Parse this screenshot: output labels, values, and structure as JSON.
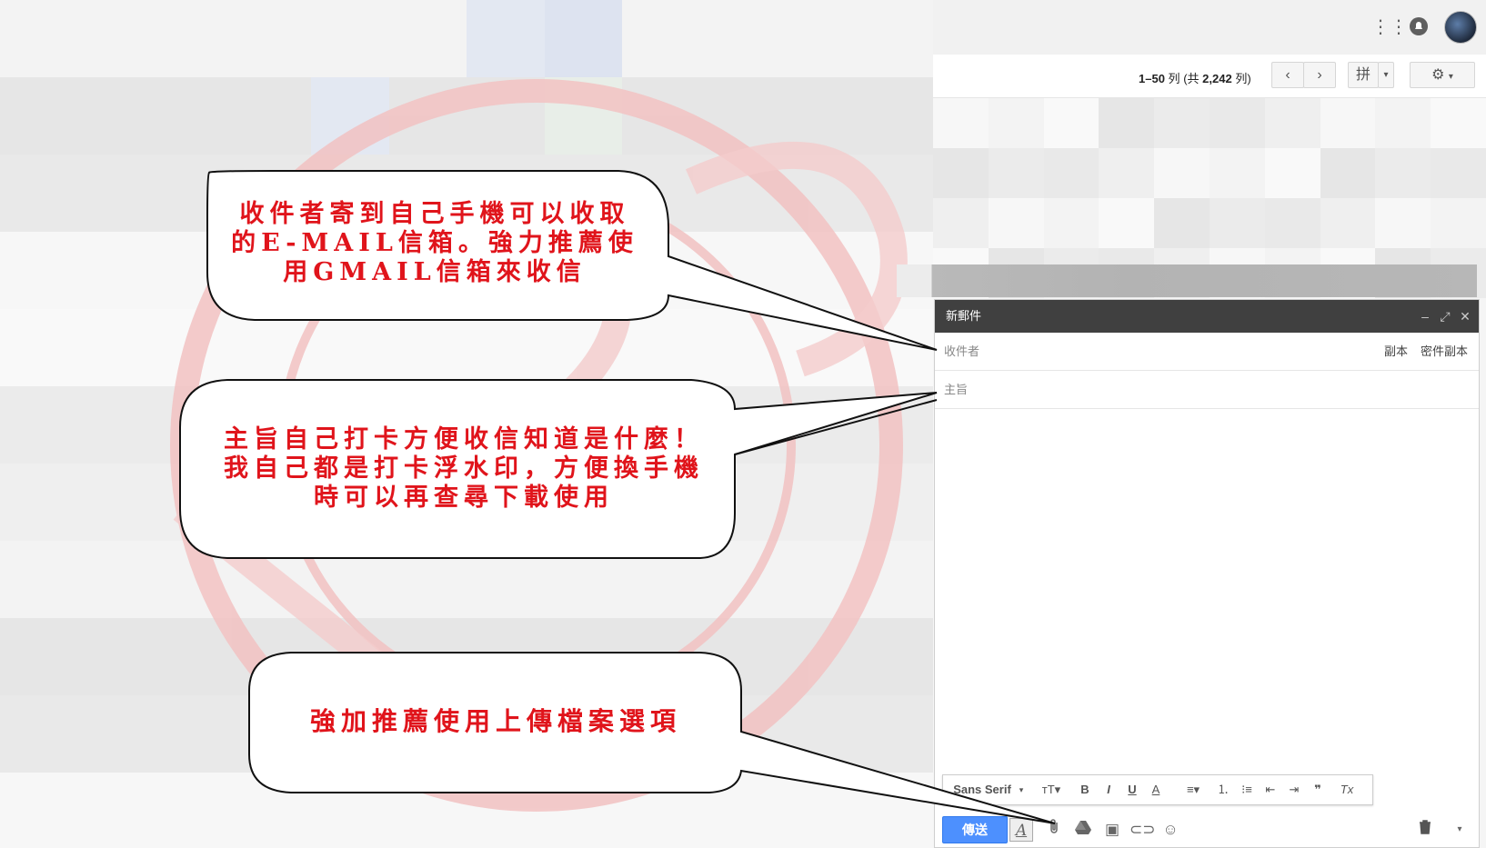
{
  "colors": {
    "annotation_text": "#e0141b",
    "send_button": "#4d90fe",
    "compose_header": "#404040"
  },
  "appbar": {
    "apps_icon": "apps-grid-icon",
    "notifications_icon": "bell-icon",
    "avatar": "user-avatar"
  },
  "toolbar": {
    "range": "1–50",
    "lie": "列",
    "total_prefix": "(共",
    "total": "2,242",
    "total_suffix": "列)",
    "prev_icon": "‹",
    "next_icon": "›",
    "input_tool_label": "拼",
    "dropdown_caret": "▾",
    "settings_icon": "⚙"
  },
  "compose": {
    "title": "新郵件",
    "minimize_icon": "–",
    "expand_icon": "⤢",
    "close_icon": "✕",
    "to_placeholder": "收件者",
    "cc_label": "副本",
    "bcc_label": "密件副本",
    "subject_placeholder": "主旨",
    "send_label": "傳送",
    "format_font": "Sans Serif",
    "format_bold": "B",
    "format_italic": "I",
    "format_underline": "U",
    "format_textcolor": "A",
    "format_clear": "Tx",
    "formatting_toggle": "A",
    "more_caret": "▾"
  },
  "callouts": {
    "recipient": "收件者寄到自己手機可以收取的E-MAIL信箱。強力推薦使用GMAIL信箱來收信",
    "subject": "主旨自己打卡方便收信知道是什麼！我自己都是打卡浮水印，方便換手機時可以再查尋下載使用",
    "attach": "強加推薦使用上傳檔案選項"
  }
}
